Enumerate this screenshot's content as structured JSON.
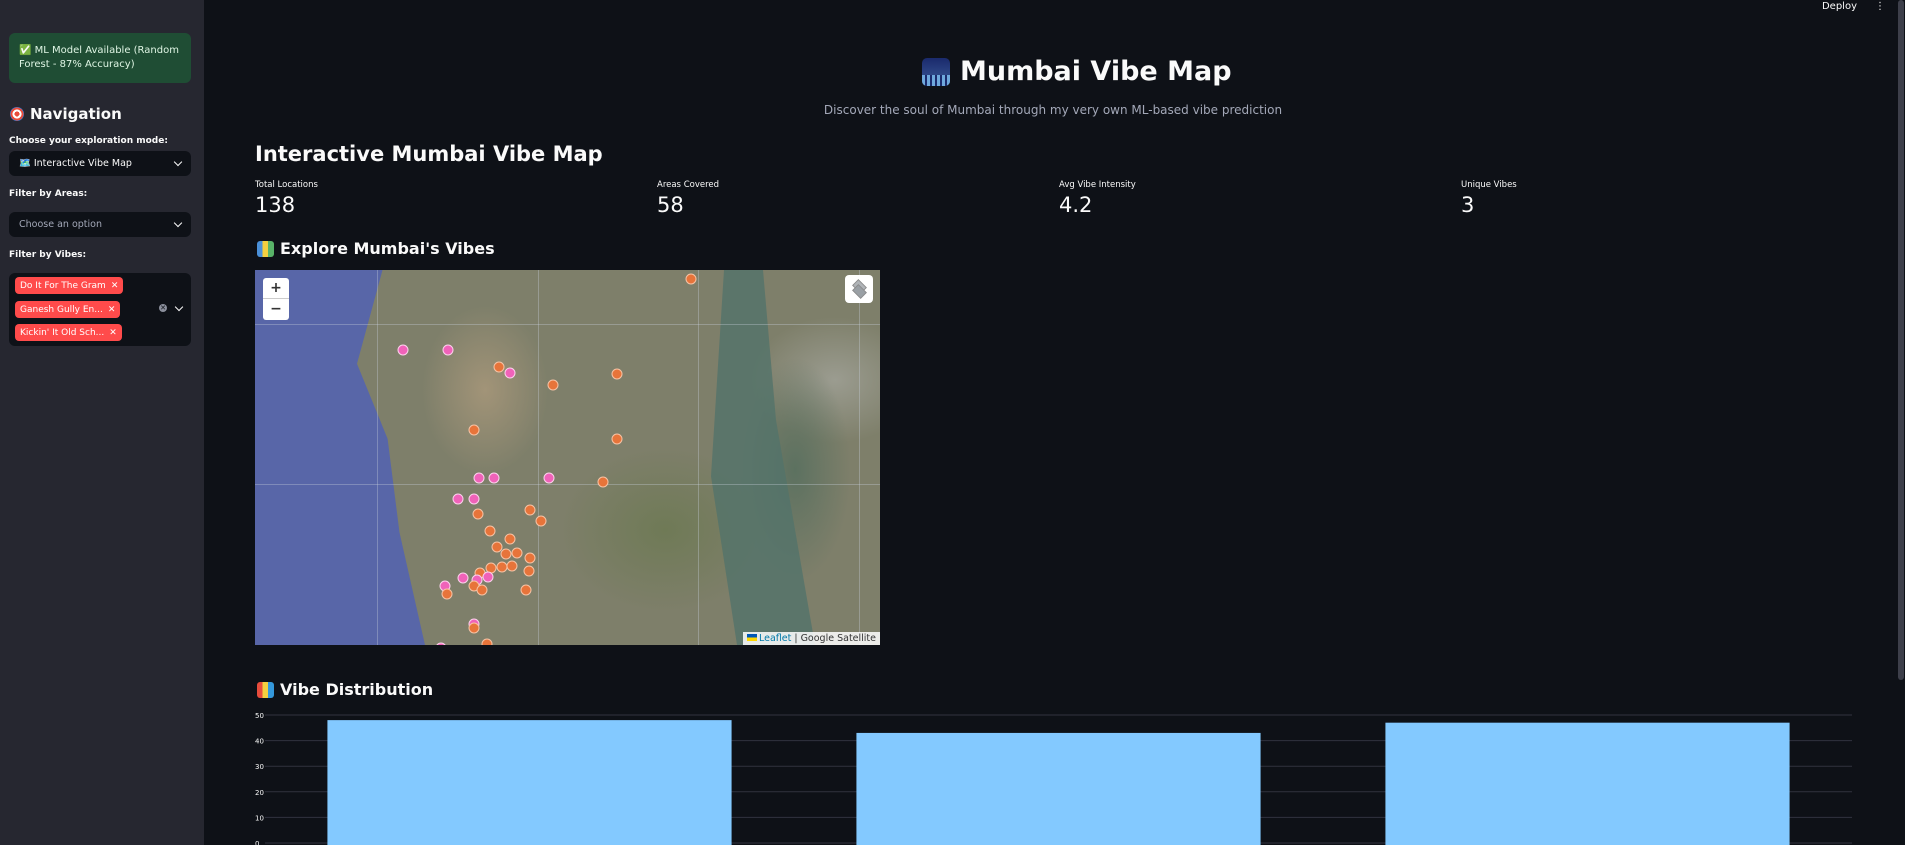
{
  "sidebar": {
    "alert": "✅ ML Model Available (Random Forest - 87% Accuracy)",
    "nav_title": "Navigation",
    "mode_label": "Choose your exploration mode:",
    "mode_value": "🗺️ Interactive Vibe Map",
    "areas_label": "Filter by Areas:",
    "areas_placeholder": "Choose an option",
    "vibes_label": "Filter by Vibes:",
    "vibe_tags": [
      "Do It For The Gram",
      "Ganesh Gully En...",
      "Kickin' It Old Sch..."
    ]
  },
  "topbar": {
    "deploy": "Deploy",
    "menu": "⋮"
  },
  "header": {
    "title": "Mumbai Vibe Map",
    "subtitle": "Discover the soul of Mumbai through my very own ML-based vibe prediction"
  },
  "section_title": "Interactive Mumbai Vibe Map",
  "metrics": [
    {
      "label": "Total Locations",
      "value": "138"
    },
    {
      "label": "Areas Covered",
      "value": "58"
    },
    {
      "label": "Avg Vibe Intensity",
      "value": "4.2"
    },
    {
      "label": "Unique Vibes",
      "value": "3"
    }
  ],
  "map": {
    "title": "Explore Mumbai's Vibes",
    "zoom_in": "+",
    "zoom_out": "−",
    "attribution_link": "Leaflet",
    "attribution_rest": " | Google Satellite"
  },
  "chart_section_title": "Vibe Distribution",
  "chart_data": {
    "type": "bar",
    "categories": [
      "",
      "",
      ""
    ],
    "values": [
      48,
      43,
      47
    ],
    "ylim": [
      0,
      50
    ],
    "yticks": [
      0,
      10,
      20,
      30,
      40,
      50
    ],
    "bar_color": "#83c9ff",
    "grid": true
  }
}
